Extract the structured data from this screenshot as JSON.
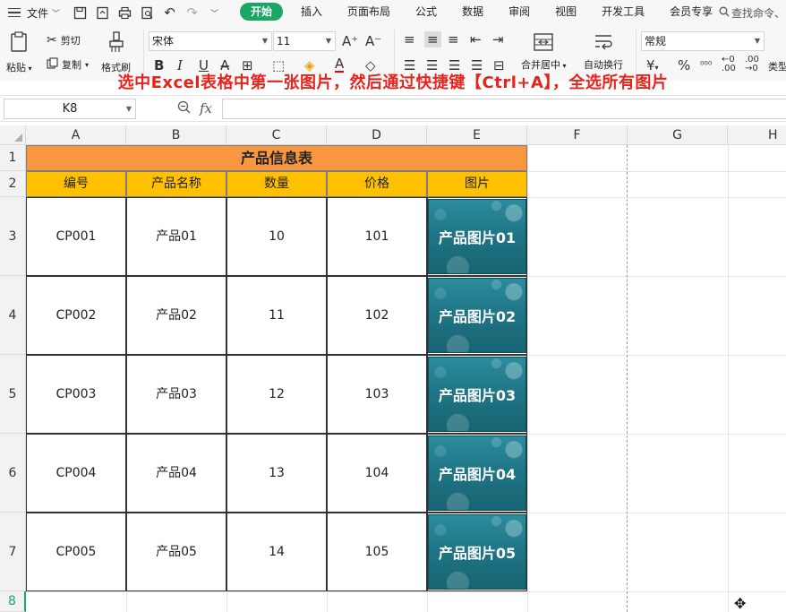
{
  "menubar": {
    "file_label": "文件",
    "tabs": [
      "开始",
      "插入",
      "页面布局",
      "公式",
      "数据",
      "审阅",
      "视图",
      "开发工具",
      "会员专享"
    ],
    "active_tab": "开始",
    "search_placeholder": "查找命令、",
    "accent_color": "#1aa764"
  },
  "ribbon": {
    "paste_label": "粘贴",
    "cut_label": "剪切",
    "copy_label": "复制",
    "format_painter_label": "格式刷",
    "font_name": "宋体",
    "font_size": "11",
    "merge_label": "合并居中",
    "wrap_label": "自动换行",
    "number_format": "常规",
    "type_label": "类型"
  },
  "banner": {
    "text": "选中Excel表格中第一张图片，然后通过快捷键【Ctrl+A】，全选所有图片",
    "color": "#e8231c"
  },
  "formula_bar": {
    "name_box": "K8",
    "fx_label": "fx",
    "formula": ""
  },
  "sheet": {
    "columns": [
      "A",
      "B",
      "C",
      "D",
      "E",
      "F",
      "G",
      "H"
    ],
    "rows": [
      "1",
      "2",
      "3",
      "4",
      "5",
      "6",
      "7",
      "8"
    ],
    "title": "产品信息表",
    "headers": [
      "编号",
      "产品名称",
      "数量",
      "价格",
      "图片"
    ],
    "data": [
      {
        "code": "CP001",
        "name": "产品01",
        "qty": "10",
        "price": "101",
        "image": "产品图片01"
      },
      {
        "code": "CP002",
        "name": "产品02",
        "qty": "11",
        "price": "102",
        "image": "产品图片02"
      },
      {
        "code": "CP003",
        "name": "产品03",
        "qty": "12",
        "price": "103",
        "image": "产品图片03"
      },
      {
        "code": "CP004",
        "name": "产品04",
        "qty": "13",
        "price": "104",
        "image": "产品图片04"
      },
      {
        "code": "CP005",
        "name": "产品05",
        "qty": "14",
        "price": "105",
        "image": "产品图片05"
      }
    ],
    "title_fill": "#f8973f",
    "header_fill": "#ffc000"
  }
}
